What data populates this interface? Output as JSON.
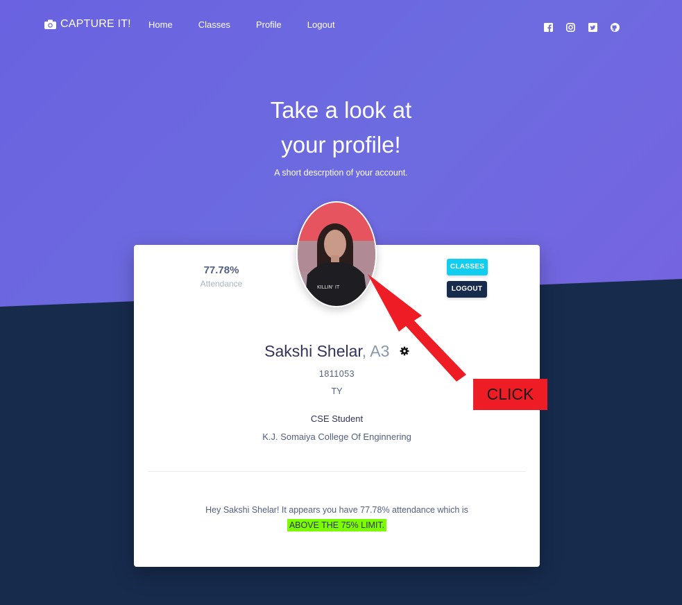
{
  "navbar": {
    "brand": "CAPTURE IT!",
    "links": [
      "Home",
      "Classes",
      "Profile",
      "Logout"
    ],
    "social_icons": [
      "facebook-icon",
      "instagram-icon",
      "twitter-icon",
      "github-icon"
    ]
  },
  "hero": {
    "title_line1": "Take a look at",
    "title_line2": "your profile!",
    "subtitle": "A short descrption of your account."
  },
  "profile": {
    "attendance_value": "77.78%",
    "attendance_label": "Attendance",
    "buttons": {
      "classes": "CLASSES",
      "logout": "LOGOUT"
    },
    "name": "Sakshi Shelar",
    "division": ", A3",
    "roll_no": "1811053",
    "year": "TY",
    "role": "CSE Student",
    "college": "K.J. Somaiya College Of Enginnering",
    "message": "Hey Sakshi Shelar! It appears you have 77.78% attendance which is",
    "status": "ABOVE THE 75% LIMIT."
  },
  "annotation": {
    "label": "CLICK"
  },
  "colors": {
    "hero_gradient": "#6d6be0",
    "dark_bg": "#172b4d",
    "classes_btn": "#11cdef",
    "logout_btn": "#172b4d",
    "highlight": "#7cfc00",
    "annotation_red": "#ee1c25"
  }
}
